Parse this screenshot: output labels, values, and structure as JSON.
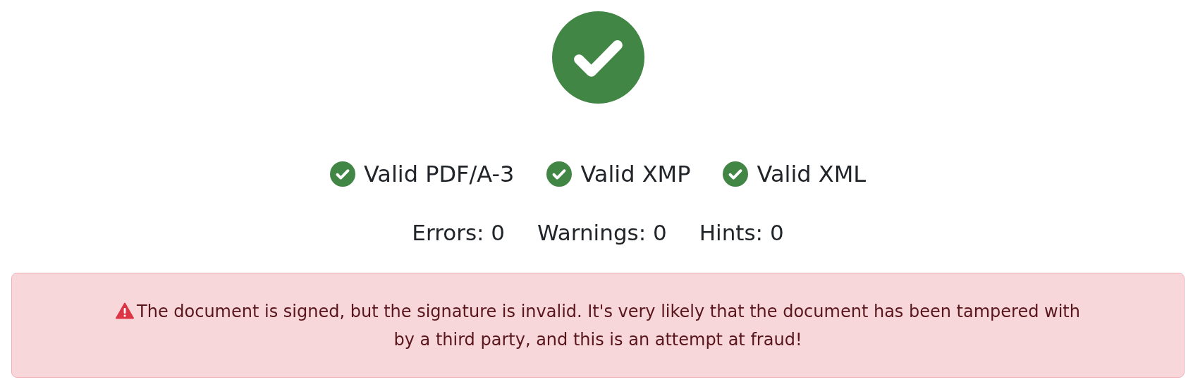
{
  "result": {
    "valid": true
  },
  "checks": [
    {
      "label": "Valid PDF/A-3",
      "valid": true
    },
    {
      "label": "Valid XMP",
      "valid": true
    },
    {
      "label": "Valid XML",
      "valid": true
    }
  ],
  "counts": [
    "Errors: 0",
    "Warnings: 0",
    "Hints: 0"
  ],
  "alert": {
    "kind": "danger",
    "text": "The document is signed, but the signature is invalid. It's very likely that the document has been tampered with by a third party, and this is an attempt at fraud!"
  }
}
